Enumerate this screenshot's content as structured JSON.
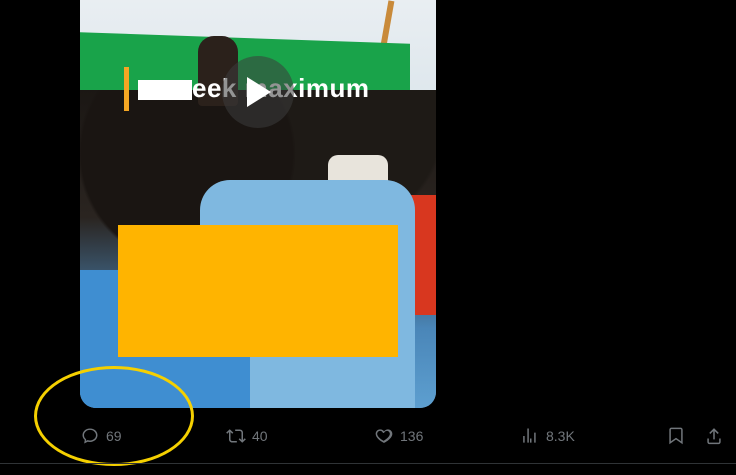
{
  "post": {
    "video": {
      "caption_text": "eek maximum",
      "play_icon": "play-icon"
    },
    "actions": {
      "replies": "69",
      "reposts": "40",
      "likes": "136",
      "views": "8.3K"
    }
  },
  "colors": {
    "background": "#000000",
    "action_gray": "#71767b",
    "highlight_ellipse": "#f5d000",
    "redaction": "#ffb400"
  }
}
